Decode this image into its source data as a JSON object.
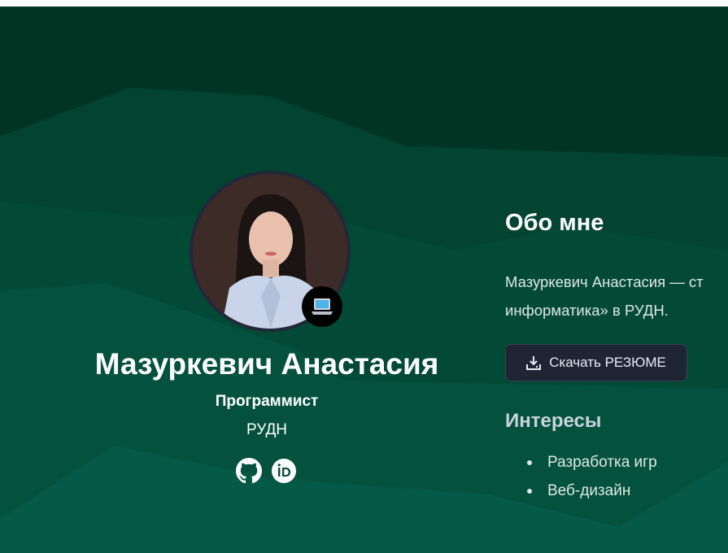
{
  "profile": {
    "name": "Мазуркевич Анастасия",
    "role": "Программист",
    "organization": "РУДН",
    "avatar_alt": "Фото профиля",
    "badge_icon": "laptop-icon",
    "social": [
      {
        "icon": "github-icon"
      },
      {
        "icon": "orcid-icon"
      }
    ]
  },
  "about": {
    "title": "Обо мне",
    "text_line1": "Мазуркевич Анастасия — ст",
    "text_line2": "информатика» в РУДН.",
    "download_label": "Скачать РЕЗЮМЕ"
  },
  "interests": {
    "title": "Интересы",
    "items": [
      "Разработка игр",
      "Веб-дизайн"
    ]
  },
  "colors": {
    "bg_dark": "#003a26",
    "button_bg": "#1f2535"
  }
}
